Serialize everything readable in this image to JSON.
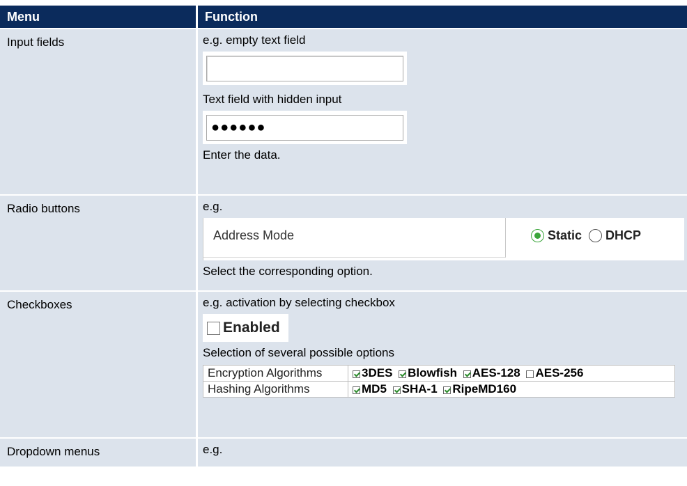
{
  "header": {
    "col1": "Menu",
    "col2": "Function"
  },
  "rows": {
    "input_fields": {
      "menu": "Input fields",
      "line1": "e.g. empty text field",
      "line2": "Text field with hidden input",
      "masked_value": "●●●●●●",
      "line3": "Enter the data."
    },
    "radio_buttons": {
      "menu": "Radio buttons",
      "line1": "e.g.",
      "demo_label": "Address Mode",
      "option1": "Static",
      "option2": "DHCP",
      "selected": "Static",
      "line2": "Select the corresponding option."
    },
    "checkboxes": {
      "menu": "Checkboxes",
      "line1": "e.g. activation by selecting checkbox",
      "enabled_label": "Enabled",
      "enabled_checked": false,
      "line2": "Selection of several possible options",
      "grid": [
        {
          "label": "Encryption Algorithms",
          "options": [
            {
              "name": "3DES",
              "checked": true
            },
            {
              "name": "Blowfish",
              "checked": true
            },
            {
              "name": "AES-128",
              "checked": true
            },
            {
              "name": "AES-256",
              "checked": false
            }
          ]
        },
        {
          "label": "Hashing Algorithms",
          "options": [
            {
              "name": "MD5",
              "checked": true
            },
            {
              "name": "SHA-1",
              "checked": true
            },
            {
              "name": "RipeMD160",
              "checked": true
            }
          ]
        }
      ]
    },
    "dropdown": {
      "menu": "Dropdown menus",
      "line1": "e.g."
    }
  }
}
